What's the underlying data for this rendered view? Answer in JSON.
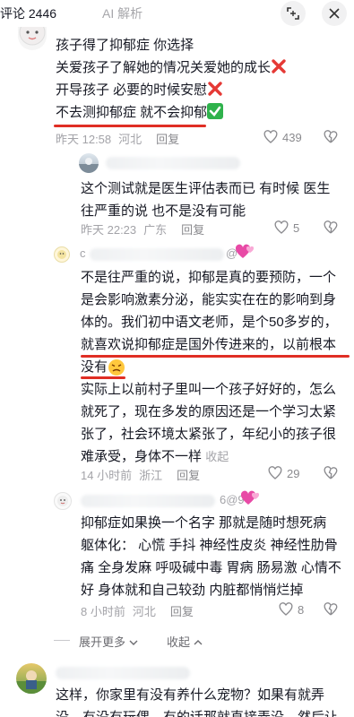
{
  "header": {
    "comments_tab": "评论 2446",
    "ai_tab": "AI 解析"
  },
  "comment1": {
    "lines": [
      "孩子得了抑郁症 你选择",
      "关爱孩子了解她的情况关爱她的成长",
      "开导孩子 必要的时候安慰",
      "不去测抑郁症 就不会抑郁"
    ],
    "time": "昨天 12:58",
    "location": "河北",
    "reply": "回复",
    "likes": "439"
  },
  "reply1": {
    "lines": [
      "这个测试就是医生评估表而已 有时候 医生",
      "往严重的说 也不是没有可能"
    ],
    "time": "昨天 22:23",
    "location": "广东",
    "reply": "回复",
    "likes": "5"
  },
  "reply2": {
    "name_prefix": "c",
    "name_suffix": "@",
    "lines": [
      "不是往严重的说，抑郁是真的要预防，一个",
      "是会影响激素分泌，能实实在在的影响到身",
      "体的。我们初中语文老师，是个50多岁的，",
      "就喜欢说抑郁症是国外传进来的，以前根本",
      "没有",
      "实际上以前村子里叫一个孩子好好的，怎么",
      "就死了，现在多发的原因还是一个学习太紧",
      "张了，社会环境太紧张了，年纪小的孩子很",
      "难承受，身体不一样"
    ],
    "collapse": "收起",
    "time": "14 小时前",
    "location": "浙江",
    "reply": "回复",
    "likes": "29"
  },
  "reply3": {
    "name_suffix": "6@9",
    "lines": [
      "抑郁症如果换一个名字 那就是随时想死病",
      "躯体化： 心慌 手抖 神经性皮炎 神经性肋骨",
      "痛 全身发麻 呼吸碱中毒 胃病 肠易激 心情不",
      "好 身体就和自己较劲 内脏都悄悄烂掉"
    ],
    "time": "8 小时前",
    "location": "河北",
    "reply": "回复",
    "likes": "8"
  },
  "thread_controls": {
    "expand_more": "展开更多",
    "collapse": "收起"
  },
  "comment2": {
    "lines": [
      "这样，你家里有没有养什么宠物？如果有就弄",
      "没，有没有玩偶，有的话那就直接弄没，然后让"
    ]
  },
  "colors": {
    "underline": "#e02e24",
    "text": "#161823",
    "meta": "#a3a3a8"
  }
}
